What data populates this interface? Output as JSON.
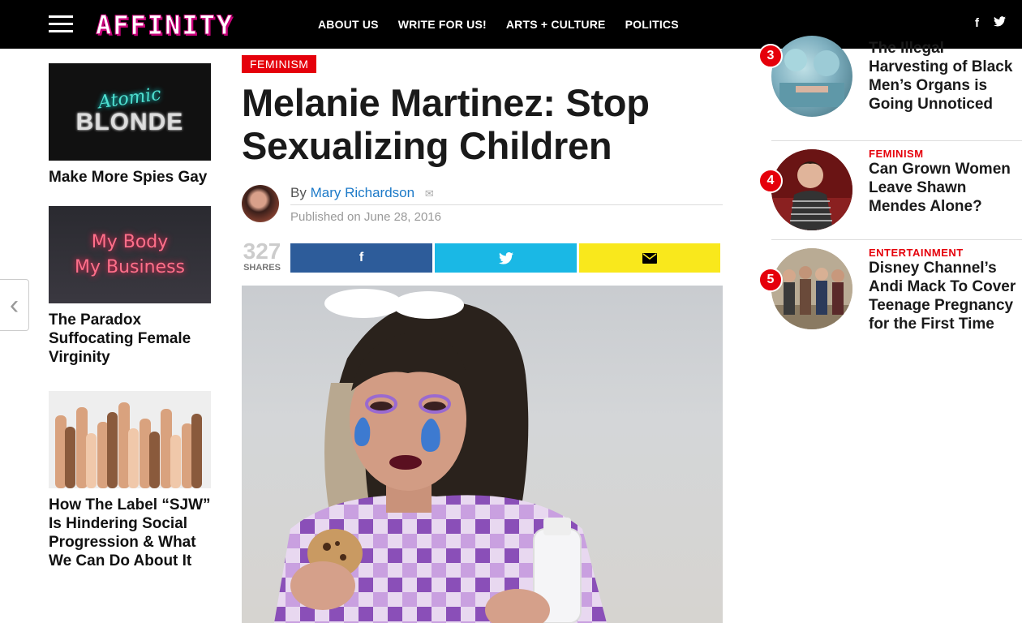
{
  "header": {
    "logo": "AFFINITY",
    "nav": [
      "ABOUT US",
      "WRITE FOR US!",
      "ARTS + CULTURE",
      "POLITICS"
    ],
    "social": {
      "facebook": "f",
      "twitter": "t"
    },
    "icons": [
      "menu-icon",
      "facebook-icon",
      "twitter-icon"
    ]
  },
  "left_sidebar": {
    "items": [
      {
        "title": "Make More Spies Gay",
        "thumb_line1": "Atomic",
        "thumb_line2": "BLONDE"
      },
      {
        "title": "The Paradox Suffocating Female Virginity",
        "thumb_line1": "My Body",
        "thumb_line2": "My Business"
      },
      {
        "title": "How The Label “SJW” Is Hindering Social Progression & What We Can Do About It"
      }
    ]
  },
  "article": {
    "category": "FEMINISM",
    "title": "Melanie Martinez: Stop Sexualizing Children",
    "by_prefix": "By",
    "author": "Mary Richardson",
    "published": "Published on June 28, 2016",
    "share_count": "327",
    "share_label": "SHARES",
    "share_buttons": {
      "facebook": "f",
      "twitter": "twitter-bird-icon",
      "email": "envelope-icon"
    }
  },
  "right_sidebar": {
    "items": [
      {
        "rank": "3",
        "category": "",
        "title": "The Illegal Harvesting of Black Men’s Organs is Going Unnoticed"
      },
      {
        "rank": "4",
        "category": "FEMINISM",
        "title": "Can Grown Women Leave Shawn Mendes Alone?"
      },
      {
        "rank": "5",
        "category": "ENTERTAINMENT",
        "title": "Disney Channel’s Andi Mack To Cover Teenage Pregnancy for the First Time"
      }
    ]
  },
  "colors": {
    "accent_red": "#e5000b",
    "facebook": "#2d5c9a",
    "twitter": "#1ab8e5",
    "email": "#f9e81c",
    "author_link": "#1d7ac8"
  }
}
